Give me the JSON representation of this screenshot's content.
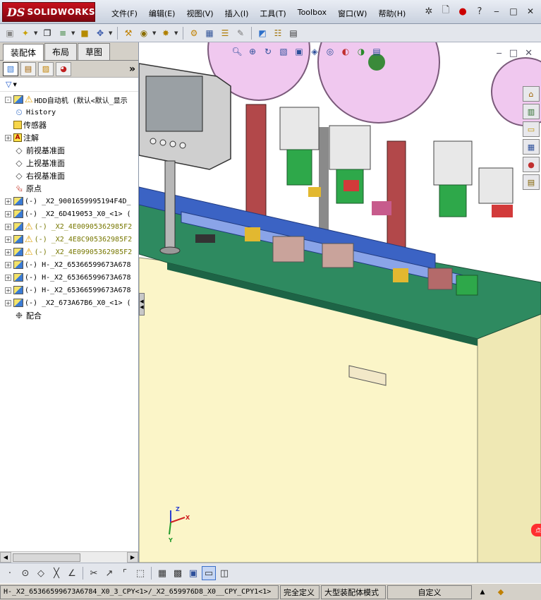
{
  "app": {
    "logo_mark": "DS",
    "logo_text": "SOLIDWORKS"
  },
  "menu": [
    "文件(F)",
    "编辑(E)",
    "视图(V)",
    "插入(I)",
    "工具(T)",
    "Toolbox",
    "窗口(W)",
    "帮助(H)"
  ],
  "title_icons": [
    "pushpin-icon",
    "new-document-icon",
    "traffic-light-icon",
    "help-icon"
  ],
  "window_buttons": [
    "minimize",
    "restore",
    "close"
  ],
  "toolbar": [
    "assembly-icon",
    "new-part-icon",
    "paperclip-icon",
    "reorder-icon",
    "smart-fastener-icon",
    "move-component-icon",
    "toolbox-icon",
    "mate-icon",
    "explode-icon",
    "bom-icon",
    "drawing-icon",
    "layout-icon",
    "sketch-icon",
    "snapshot-icon",
    "measure-icon",
    "options-icon"
  ],
  "left_panel": {
    "tabs": [
      "装配体",
      "布局",
      "草图"
    ],
    "active_tab": "装配体",
    "manager_icons": [
      "feature-manager-icon",
      "property-manager-icon",
      "configuration-manager-icon",
      "display-manager-icon"
    ],
    "more": "»",
    "tree": [
      {
        "expander": "-",
        "icon": "assembly",
        "warn": true,
        "label": "HDD自动机  (默认<默认_显示"
      },
      {
        "expander": "",
        "icon": "history",
        "warn": false,
        "label": "History"
      },
      {
        "expander": "",
        "icon": "sensor",
        "warn": false,
        "label": "传感器"
      },
      {
        "expander": "+",
        "icon": "annotation",
        "warn": false,
        "label": "注解"
      },
      {
        "expander": "",
        "icon": "plane",
        "warn": false,
        "label": "前视基准面"
      },
      {
        "expander": "",
        "icon": "plane",
        "warn": false,
        "label": "上视基准面"
      },
      {
        "expander": "",
        "icon": "plane",
        "warn": false,
        "label": "右视基准面"
      },
      {
        "expander": "",
        "icon": "origin",
        "warn": false,
        "label": "原点"
      },
      {
        "expander": "+",
        "icon": "assembly",
        "warn": false,
        "label": "(-) _X2_9001659995194F4D_"
      },
      {
        "expander": "+",
        "icon": "assembly",
        "warn": false,
        "label": "(-) _X2_6D419053_X0_<1> ("
      },
      {
        "expander": "+",
        "icon": "assembly",
        "warn": true,
        "label": "(-) _X2_4E00905362985F2"
      },
      {
        "expander": "+",
        "icon": "assembly",
        "warn": true,
        "label": "(-) _X2_4E8C905362985F2"
      },
      {
        "expander": "+",
        "icon": "assembly",
        "warn": true,
        "label": "(-) _X2_4E09905362985F2"
      },
      {
        "expander": "+",
        "icon": "assembly",
        "warn": false,
        "label": "(-) H-_X2_65366599673A678"
      },
      {
        "expander": "+",
        "icon": "assembly",
        "warn": false,
        "label": "(-) H-_X2_65366599673A678"
      },
      {
        "expander": "+",
        "icon": "assembly",
        "warn": false,
        "label": "(-) H-_X2_65366599673A678"
      },
      {
        "expander": "+",
        "icon": "assembly",
        "warn": false,
        "label": "(-) _X2_673A67B6_X0_<1> ("
      },
      {
        "expander": "",
        "icon": "mate",
        "warn": false,
        "label": "配合"
      }
    ]
  },
  "graphics": {
    "heads_up_icons": [
      "zoom-to-fit-icon",
      "zoom-area-icon",
      "rotate-icon",
      "section-view-icon",
      "view-orientation-icon",
      "display-style-icon",
      "hide-show-icon",
      "edit-appearance-icon",
      "apply-scene-icon",
      "view-settings-icon"
    ],
    "task_pane_icons": [
      "resources-icon",
      "design-library-icon",
      "file-explorer-icon",
      "view-palette-icon",
      "appearances-icon",
      "custom-properties-icon"
    ],
    "triad_labels": {
      "x": "X",
      "y": "Y",
      "z": "Z"
    },
    "side_tag": "点"
  },
  "bottom_toolbar": [
    "point-icon",
    "circle-icon",
    "polygon-icon",
    "cross-icon",
    "angle-icon",
    "trim-icon",
    "extend-icon",
    "corner-icon",
    "dotted-corner-icon",
    "grid-icon",
    "grid-snap-icon",
    "shaded-cube-icon",
    "front-view-icon",
    "split-view-icon"
  ],
  "status": {
    "path": "H-_X2_65366599673A6784_X0_3_CPY<1>/_X2_659976D8_X0__CPY_CPY1<1>",
    "definition": "完全定义",
    "mode": "大型装配体模式",
    "custom": "自定义",
    "up_arrow": "▲"
  }
}
